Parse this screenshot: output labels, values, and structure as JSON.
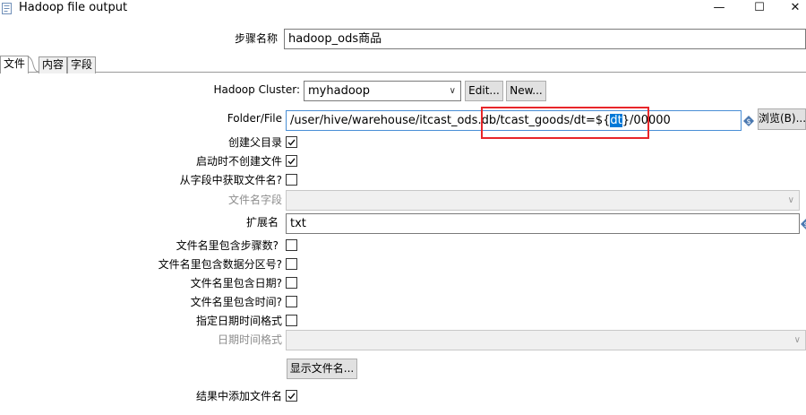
{
  "window": {
    "title": "Hadoop file output",
    "minimize": "—",
    "maximize": "☐",
    "close": "✕"
  },
  "step_name": {
    "label": "步骤名称",
    "value": "hadoop_ods商品"
  },
  "tabs": [
    "文件",
    "内容",
    "字段"
  ],
  "cluster": {
    "label": "Hadoop Cluster:",
    "value": "myhadoop",
    "edit": "Edit...",
    "new": "New..."
  },
  "folder": {
    "label": "Folder/File",
    "value_before": "/user/hive/warehouse/itcast_ods.db/tcast_goods/dt=${",
    "value_selected": "dt",
    "value_after": "}/00000",
    "browse": "浏览(B)..."
  },
  "create_parent": {
    "label": "创建父目录",
    "checked": true
  },
  "no_create_at_start": {
    "label": "启动时不创建文件",
    "checked": true
  },
  "filename_from_field": {
    "label": "从字段中获取文件名?",
    "checked": false
  },
  "filename_field": {
    "label": "文件名字段",
    "value": ""
  },
  "extension": {
    "label": "扩展名",
    "value": "txt"
  },
  "include_stepnr": {
    "label": "文件名里包含步骤数?",
    "checked": false
  },
  "include_partnr": {
    "label": "文件名里包含数据分区号?",
    "checked": false
  },
  "include_date": {
    "label": "文件名里包含日期?",
    "checked": false
  },
  "include_time": {
    "label": "文件名里包含时间?",
    "checked": false
  },
  "specify_format": {
    "label": "指定日期时间格式",
    "checked": false
  },
  "date_format": {
    "label": "日期时间格式",
    "value": ""
  },
  "show_filenames": "显示文件名...",
  "add_to_result": {
    "label": "结果中添加文件名",
    "checked": true
  },
  "colors": {
    "highlight_box": "#e8262a",
    "selection": "#0078d7",
    "var_icon": "#4a78b0"
  }
}
